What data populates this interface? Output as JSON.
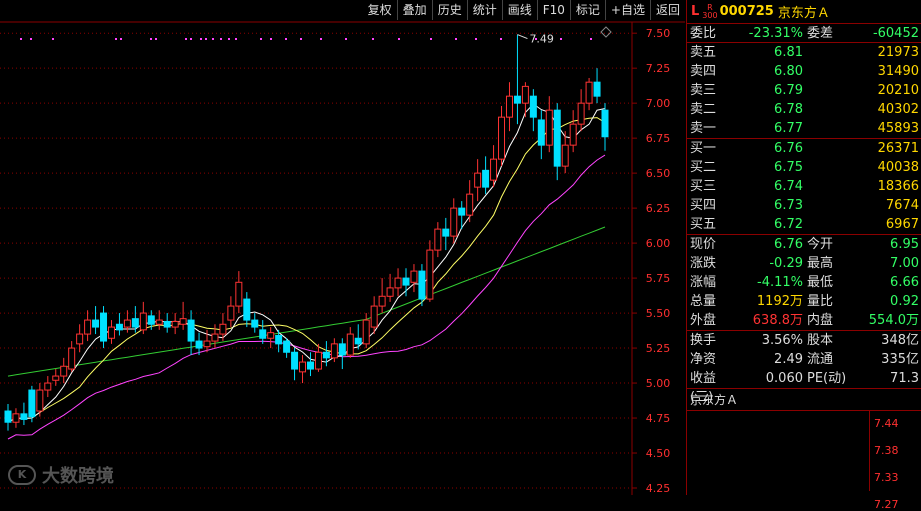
{
  "toolbar": [
    "复权",
    "叠加",
    "历史",
    "统计",
    "画线",
    "F10",
    "标记",
    "+自选",
    "返回"
  ],
  "header": {
    "flag_l": "L",
    "flag_r": "R",
    "flag_300": "300",
    "code": "000725",
    "name": "京东方Ａ"
  },
  "order_ratio": {
    "label": "委比",
    "value": "-23.31%",
    "label2": "委差",
    "value2": "-60452"
  },
  "sells": [
    {
      "label": "卖五",
      "price": "6.81",
      "vol": "21973"
    },
    {
      "label": "卖四",
      "price": "6.80",
      "vol": "31490"
    },
    {
      "label": "卖三",
      "price": "6.79",
      "vol": "20210"
    },
    {
      "label": "卖二",
      "price": "6.78",
      "vol": "40302"
    },
    {
      "label": "卖一",
      "price": "6.77",
      "vol": "45893"
    }
  ],
  "buys": [
    {
      "label": "买一",
      "price": "6.76",
      "vol": "26371"
    },
    {
      "label": "买二",
      "price": "6.75",
      "vol": "40038"
    },
    {
      "label": "买三",
      "price": "6.74",
      "vol": "18366"
    },
    {
      "label": "买四",
      "price": "6.73",
      "vol": "7674"
    },
    {
      "label": "买五",
      "price": "6.72",
      "vol": "6967"
    }
  ],
  "quote": [
    {
      "l1": "现价",
      "v1": "6.76",
      "c1": "green",
      "l2": "今开",
      "v2": "6.95",
      "c2": "green"
    },
    {
      "l1": "涨跌",
      "v1": "-0.29",
      "c1": "green",
      "l2": "最高",
      "v2": "7.00",
      "c2": "green"
    },
    {
      "l1": "涨幅",
      "v1": "-4.11%",
      "c1": "green",
      "l2": "最低",
      "v2": "6.66",
      "c2": "green"
    },
    {
      "l1": "总量",
      "v1": "1192万",
      "c1": "yellow",
      "l2": "量比",
      "v2": "0.92",
      "c2": "green"
    },
    {
      "l1": "外盘",
      "v1": "638.8万",
      "c1": "red",
      "l2": "内盘",
      "v2": "554.0万",
      "c2": "green"
    }
  ],
  "stats": [
    {
      "l1": "换手",
      "v1": "3.56%",
      "l2": "股本",
      "v2": "348亿"
    },
    {
      "l1": "净资",
      "v1": "2.49",
      "l2": "流通",
      "v2": "335亿"
    },
    {
      "l1": "收益(三)",
      "v1": "0.060",
      "l2": "PE(动)",
      "v2": "71.3"
    }
  ],
  "mini": {
    "title": "京东方Ａ",
    "ticks": [
      "7.44",
      "7.38",
      "7.33",
      "7.27"
    ]
  },
  "watermark": "大数跨境",
  "watermark_icon": "K",
  "colors": {
    "up": "#ff3333",
    "down": "#00e0ff",
    "ma5": "#ffffff",
    "ma10": "#ffff66",
    "ma20": "#ff44ff",
    "ma60": "#33cc33",
    "grid": "#8b0000"
  },
  "chart_data": {
    "type": "candlestick",
    "yticks": [
      "7.50",
      "7.25",
      "7.00",
      "6.75",
      "6.50",
      "6.25",
      "6.00",
      "5.75",
      "5.50",
      "5.25",
      "5.00",
      "4.75",
      "4.50",
      "4.25"
    ],
    "ylim": [
      4.2,
      7.58
    ],
    "max_label": "7.49",
    "candles": [
      [
        4.8,
        4.72,
        4.85,
        4.66
      ],
      [
        4.72,
        4.78,
        4.82,
        4.68
      ],
      [
        4.78,
        4.74,
        4.86,
        4.7
      ],
      [
        4.95,
        4.76,
        4.98,
        4.72
      ],
      [
        4.8,
        4.95,
        5.0,
        4.76
      ],
      [
        4.95,
        5.0,
        5.05,
        4.9
      ],
      [
        5.02,
        5.05,
        5.1,
        4.98
      ],
      [
        5.05,
        5.12,
        5.18,
        5.0
      ],
      [
        5.1,
        5.25,
        5.3,
        5.08
      ],
      [
        5.28,
        5.35,
        5.42,
        5.22
      ],
      [
        5.35,
        5.45,
        5.52,
        5.3
      ],
      [
        5.45,
        5.4,
        5.55,
        5.35
      ],
      [
        5.5,
        5.3,
        5.55,
        5.25
      ],
      [
        5.32,
        5.4,
        5.45,
        5.28
      ],
      [
        5.42,
        5.38,
        5.5,
        5.34
      ],
      [
        5.4,
        5.45,
        5.52,
        5.36
      ],
      [
        5.46,
        5.4,
        5.55,
        5.36
      ],
      [
        5.38,
        5.5,
        5.58,
        5.35
      ],
      [
        5.48,
        5.42,
        5.52,
        5.38
      ],
      [
        5.42,
        5.45,
        5.52,
        5.38
      ],
      [
        5.44,
        5.4,
        5.5,
        5.36
      ],
      [
        5.4,
        5.44,
        5.5,
        5.35
      ],
      [
        5.42,
        5.46,
        5.58,
        5.38
      ],
      [
        5.45,
        5.3,
        5.52,
        5.2
      ],
      [
        5.3,
        5.25,
        5.36,
        5.2
      ],
      [
        5.26,
        5.3,
        5.38,
        5.22
      ],
      [
        5.3,
        5.35,
        5.42,
        5.25
      ],
      [
        5.35,
        5.42,
        5.5,
        5.3
      ],
      [
        5.45,
        5.55,
        5.62,
        5.4
      ],
      [
        5.55,
        5.72,
        5.8,
        5.5
      ],
      [
        5.6,
        5.45,
        5.65,
        5.4
      ],
      [
        5.45,
        5.4,
        5.5,
        5.36
      ],
      [
        5.38,
        5.32,
        5.45,
        5.28
      ],
      [
        5.32,
        5.36,
        5.4,
        5.25
      ],
      [
        5.34,
        5.28,
        5.38,
        5.22
      ],
      [
        5.3,
        5.22,
        5.32,
        5.18
      ],
      [
        5.22,
        5.1,
        5.25,
        5.02
      ],
      [
        5.08,
        5.15,
        5.2,
        5.0
      ],
      [
        5.15,
        5.1,
        5.22,
        5.05
      ],
      [
        5.1,
        5.22,
        5.28,
        5.08
      ],
      [
        5.22,
        5.18,
        5.3,
        5.12
      ],
      [
        5.18,
        5.28,
        5.32,
        5.15
      ],
      [
        5.28,
        5.2,
        5.32,
        5.1
      ],
      [
        5.2,
        5.35,
        5.4,
        5.18
      ],
      [
        5.32,
        5.28,
        5.42,
        5.24
      ],
      [
        5.28,
        5.45,
        5.5,
        5.25
      ],
      [
        5.4,
        5.55,
        5.62,
        5.35
      ],
      [
        5.55,
        5.62,
        5.75,
        5.5
      ],
      [
        5.62,
        5.68,
        5.78,
        5.58
      ],
      [
        5.68,
        5.75,
        5.82,
        5.62
      ],
      [
        5.75,
        5.7,
        5.82,
        5.62
      ],
      [
        5.72,
        5.8,
        5.85,
        5.65
      ],
      [
        5.8,
        5.6,
        5.85,
        5.55
      ],
      [
        5.6,
        5.95,
        6.02,
        5.58
      ],
      [
        5.95,
        6.1,
        6.15,
        5.9
      ],
      [
        6.1,
        6.05,
        6.18,
        5.95
      ],
      [
        6.05,
        6.25,
        6.32,
        6.0
      ],
      [
        6.25,
        6.2,
        6.3,
        6.1
      ],
      [
        6.2,
        6.35,
        6.45,
        6.15
      ],
      [
        6.4,
        6.5,
        6.6,
        6.3
      ],
      [
        6.52,
        6.4,
        6.62,
        6.35
      ],
      [
        6.45,
        6.6,
        6.7,
        6.4
      ],
      [
        6.6,
        6.9,
        6.98,
        6.55
      ],
      [
        6.9,
        7.05,
        7.15,
        6.8
      ],
      [
        7.05,
        7.0,
        7.49,
        6.85
      ],
      [
        7.0,
        7.12,
        7.15,
        6.9
      ],
      [
        7.05,
        6.9,
        7.1,
        6.8
      ],
      [
        6.88,
        6.7,
        6.95,
        6.6
      ],
      [
        6.7,
        6.95,
        7.05,
        6.65
      ],
      [
        6.95,
        6.55,
        7.0,
        6.45
      ],
      [
        6.55,
        6.7,
        6.8,
        6.5
      ],
      [
        6.7,
        6.85,
        6.95,
        6.65
      ],
      [
        6.85,
        7.0,
        7.1,
        6.8
      ],
      [
        7.0,
        7.15,
        7.18,
        6.95
      ],
      [
        7.15,
        7.05,
        7.25,
        7.0
      ],
      [
        6.95,
        6.76,
        7.0,
        6.66
      ]
    ]
  }
}
